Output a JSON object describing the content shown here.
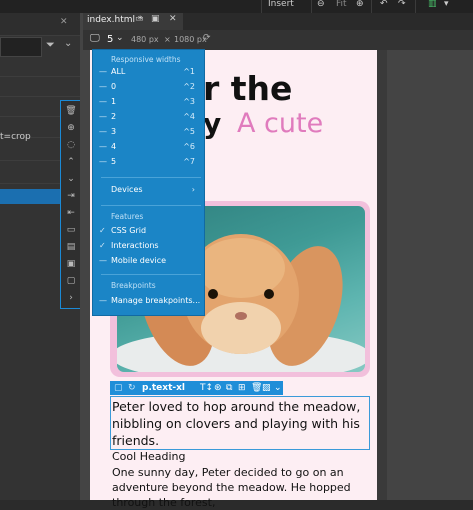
{
  "top": {
    "insert_label": "Insert",
    "fit_label": "Fit"
  },
  "left": {
    "crop_label": "t=crop"
  },
  "tab": {
    "filename": "index.html *"
  },
  "toolbar": {
    "width_label": "480 px",
    "height_label": "1080 px",
    "breakpoint_value": "5"
  },
  "dropdown": {
    "header_widths": "Responsive widths",
    "widths": [
      {
        "label": "ALL",
        "shortcut": "^1"
      },
      {
        "label": "0",
        "shortcut": "^2"
      },
      {
        "label": "1",
        "shortcut": "^3"
      },
      {
        "label": "2",
        "shortcut": "^4"
      },
      {
        "label": "3",
        "shortcut": "^5"
      },
      {
        "label": "4",
        "shortcut": "^6"
      },
      {
        "label": "5",
        "shortcut": "^7"
      }
    ],
    "devices": "Devices",
    "header_features": "Features",
    "features": [
      {
        "label": "CSS Grid",
        "checked": true
      },
      {
        "label": "Interactions",
        "checked": true
      },
      {
        "label": "Mobile device",
        "checked": false
      }
    ],
    "header_breakpoints": "Breakpoints",
    "manage": "Manage breakpoints..."
  },
  "page": {
    "headline_1": "r the",
    "headline_2": "y",
    "headline_accent": "A cute",
    "selection_tag": "p.text-xl",
    "paragraph": "Peter loved to hop around the meadow, nibbling on clovers and playing with his friends.",
    "cool_heading": "Cool Heading",
    "body_text": "One sunny day, Peter decided to go on an adventure beyond the meadow. He hopped through the forest,"
  },
  "colors": {
    "accent": "#1b85c6",
    "pink": "#e07bbd",
    "page_bg": "#fdeef3"
  }
}
